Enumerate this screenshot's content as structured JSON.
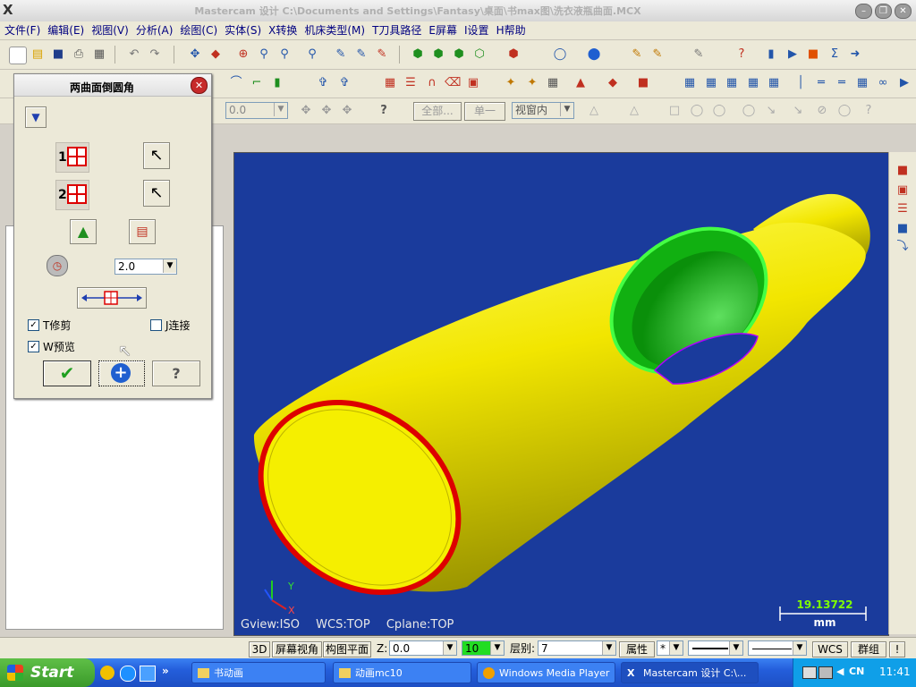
{
  "window": {
    "title": "Mastercam 设计  C:\\Documents and Settings\\Fantasy\\桌面\\书max图\\洗衣液瓶曲面.MCX",
    "app_icon": "X"
  },
  "menu": [
    "文件(F)",
    "编辑(E)",
    "视图(V)",
    "分析(A)",
    "绘图(C)",
    "实体(S)",
    "X转换",
    "机床类型(M)",
    "T刀具路径",
    "E屏幕",
    "I设置",
    "H帮助"
  ],
  "toolbar3": {
    "field_value": "0.0",
    "all_button": "全部...",
    "single_button": "单一",
    "view_select": "视窗内"
  },
  "dialog": {
    "title": "两曲面倒圆角",
    "surface1_label": "1",
    "surface2_label": "2",
    "radius_value": "2.0",
    "trim_label": "T修剪",
    "trim_checked": true,
    "connect_label": "J连接",
    "connect_checked": false,
    "preview_label": "W预览",
    "preview_checked": true
  },
  "viewport": {
    "gview": "Gview:ISO",
    "wcs": "WCS:TOP",
    "cplane": "Cplane:TOP",
    "scale_value": "19.13722",
    "scale_unit": "mm",
    "axis_y": "Y",
    "axis_x": "X",
    "background": "#1a3b9c"
  },
  "statusbar": {
    "mode_3d": "3D",
    "screen_view": "屏幕视角",
    "plane": "构图平面",
    "z_label": "Z:",
    "z_value": "0.0",
    "color_value": "10",
    "level_label": "层别:",
    "level_value": "7",
    "attr_label": "属性",
    "point_style": "*",
    "wcs": "WCS",
    "group": "群组",
    "help": "!"
  },
  "taskbar": {
    "start": "Start",
    "tasks": [
      {
        "label": "书动画"
      },
      {
        "label": "动画mc10"
      },
      {
        "label": "Windows Media Player"
      },
      {
        "label": "Mastercam 设计 C:\\..."
      }
    ],
    "lang": "CN",
    "clock": "11:41"
  }
}
